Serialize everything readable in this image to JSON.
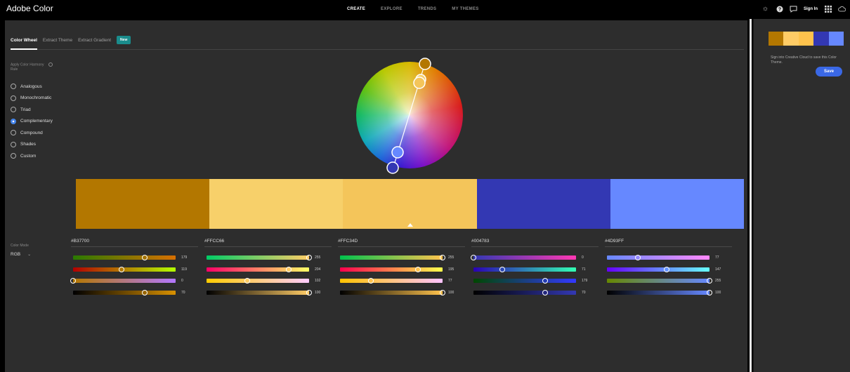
{
  "app": {
    "title": "Adobe Color"
  },
  "nav": {
    "items": [
      "CREATE",
      "EXPLORE",
      "TRENDS",
      "MY THEMES"
    ],
    "active": 0
  },
  "top_right": {
    "signin": "Sign In",
    "icons": [
      "brightness-icon",
      "help-icon",
      "feedback-icon",
      "apps-grid-icon",
      "creative-cloud-icon"
    ]
  },
  "tabs": [
    {
      "label": "Color Wheel",
      "active": true
    },
    {
      "label": "Extract Theme"
    },
    {
      "label": "Extract Gradient"
    }
  ],
  "badge_new": "New",
  "harmony": {
    "title": "Apply Color Harmony",
    "title_line2": "Rule",
    "rules": [
      "Analogous",
      "Monochromatic",
      "Triad",
      "Complementary",
      "Compound",
      "Shades",
      "Custom"
    ],
    "selected": 3
  },
  "colors": [
    "#B37700",
    "#FFCC66",
    "#FFC34D",
    "#004783",
    "#4D93FF"
  ],
  "swatch_colors": [
    "#B37700",
    "#F7D06A",
    "#F4C55A",
    "#3338B3",
    "#6688FF"
  ],
  "selected_swatch": 2,
  "color_mode": {
    "label": "Color Mode",
    "value": "RGB"
  },
  "columns": [
    {
      "hex": "#B37700",
      "values": [
        "179",
        "119",
        "0",
        "70"
      ]
    },
    {
      "hex": "#FFCC66",
      "values": [
        "255",
        "204",
        "102",
        "100"
      ]
    },
    {
      "hex": "#FFC34D",
      "values": [
        "255",
        "195",
        "77",
        "100"
      ]
    },
    {
      "hex": "#004783",
      "values": [
        "0",
        "71",
        "179",
        "70"
      ]
    },
    {
      "hex": "#4D93FF",
      "values": [
        "77",
        "147",
        "255",
        "100"
      ]
    }
  ],
  "knob_fractions": [
    [
      0.7,
      0.47,
      0.0,
      0.7
    ],
    [
      1.0,
      0.8,
      0.4,
      1.0
    ],
    [
      1.0,
      0.76,
      0.3,
      1.0
    ],
    [
      0.0,
      0.28,
      0.7,
      0.7
    ],
    [
      0.3,
      0.58,
      1.0,
      1.0
    ]
  ],
  "right_panel": {
    "theme_colors": [
      "#B37700",
      "#FFCC66",
      "#FFC34D",
      "#3338B3",
      "#6688FF"
    ],
    "signin_text": "Sign into Creative Cloud to save this Color Theme.",
    "save_label": "Save"
  }
}
